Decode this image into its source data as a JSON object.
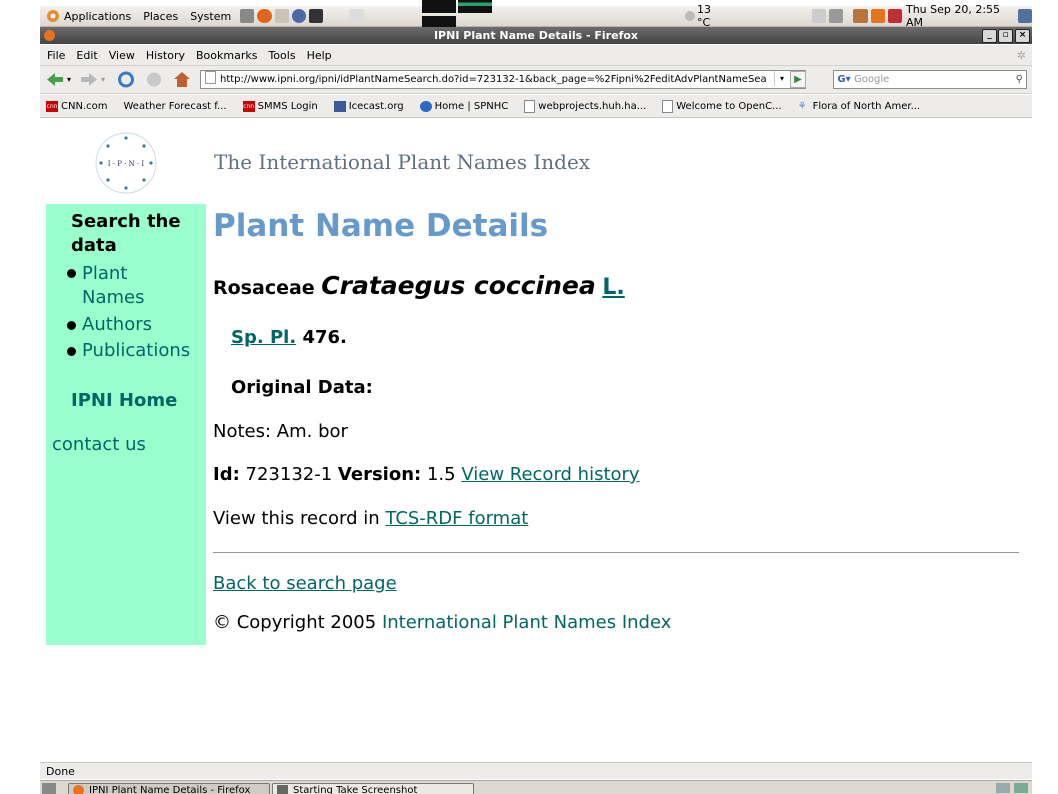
{
  "gnome_panel": {
    "menus": [
      "Applications",
      "Places",
      "System"
    ],
    "weather": "13 °C",
    "datetime": "Thu Sep 20,  2:55 AM"
  },
  "window": {
    "title": "IPNI Plant Name Details - Firefox"
  },
  "menubar": [
    "File",
    "Edit",
    "View",
    "History",
    "Bookmarks",
    "Tools",
    "Help"
  ],
  "toolbar": {
    "url": "http://www.ipni.org/ipni/idPlantNameSearch.do?id=723132-1&back_page=%2Fipni%2FeditAdvPlantNameSea",
    "search_placeholder": "Google"
  },
  "bookmarks": [
    "CNN.com",
    "Weather Forecast f...",
    "SMMS Login",
    "Icecast.org",
    "Home | SPNHC",
    "webprojects.huh.ha...",
    "Welcome to OpenC...",
    "Flora of North Amer..."
  ],
  "header": {
    "site_title": "The International Plant Names Index"
  },
  "sidebar": {
    "heading": "Search the data",
    "items": [
      "Plant Names",
      "Authors",
      "Publications"
    ],
    "home": "IPNI Home",
    "contact": "contact us"
  },
  "main": {
    "page_title": "Plant Name Details",
    "family": "Rosaceae",
    "taxon": "Crataegus coccinea",
    "author": "L.",
    "publication": "Sp. Pl.",
    "pub_collation": "476.",
    "original_data_label": "Original Data:",
    "notes": "Notes: Am. bor",
    "id_label": "Id:",
    "id_value": "723132-1",
    "version_label": "Version:",
    "version_value": "1.5",
    "history_link": "View Record history",
    "view_in": "View this record in",
    "tcs_link": "TCS-RDF format",
    "back_link": "Back to search page",
    "copyright": "© Copyright 2005",
    "copyright_link": "International Plant Names Index"
  },
  "statusbar": {
    "text": "Done"
  },
  "taskbar": {
    "tasks": [
      "IPNI Plant Name Details - Firefox",
      "Starting Take Screenshot"
    ]
  }
}
